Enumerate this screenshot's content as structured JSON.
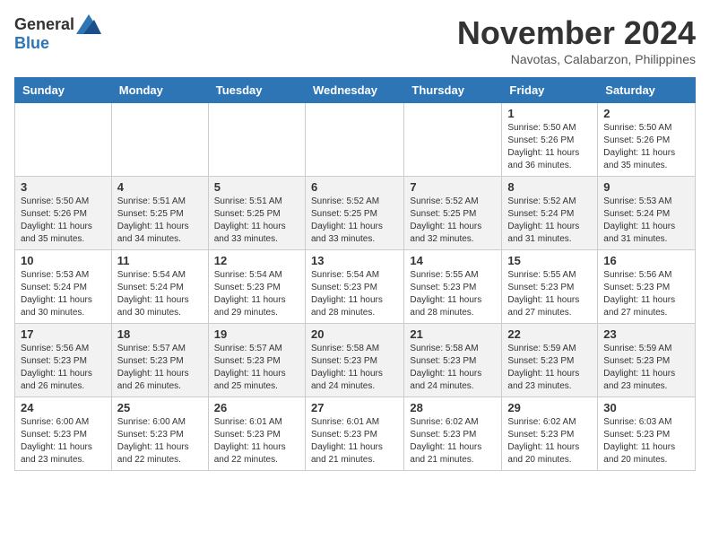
{
  "header": {
    "logo_general": "General",
    "logo_blue": "Blue",
    "month_title": "November 2024",
    "subtitle": "Navotas, Calabarzon, Philippines"
  },
  "weekdays": [
    "Sunday",
    "Monday",
    "Tuesday",
    "Wednesday",
    "Thursday",
    "Friday",
    "Saturday"
  ],
  "weeks": [
    [
      {
        "day": "",
        "info": ""
      },
      {
        "day": "",
        "info": ""
      },
      {
        "day": "",
        "info": ""
      },
      {
        "day": "",
        "info": ""
      },
      {
        "day": "",
        "info": ""
      },
      {
        "day": "1",
        "info": "Sunrise: 5:50 AM\nSunset: 5:26 PM\nDaylight: 11 hours and 36 minutes."
      },
      {
        "day": "2",
        "info": "Sunrise: 5:50 AM\nSunset: 5:26 PM\nDaylight: 11 hours and 35 minutes."
      }
    ],
    [
      {
        "day": "3",
        "info": "Sunrise: 5:50 AM\nSunset: 5:26 PM\nDaylight: 11 hours and 35 minutes."
      },
      {
        "day": "4",
        "info": "Sunrise: 5:51 AM\nSunset: 5:25 PM\nDaylight: 11 hours and 34 minutes."
      },
      {
        "day": "5",
        "info": "Sunrise: 5:51 AM\nSunset: 5:25 PM\nDaylight: 11 hours and 33 minutes."
      },
      {
        "day": "6",
        "info": "Sunrise: 5:52 AM\nSunset: 5:25 PM\nDaylight: 11 hours and 33 minutes."
      },
      {
        "day": "7",
        "info": "Sunrise: 5:52 AM\nSunset: 5:25 PM\nDaylight: 11 hours and 32 minutes."
      },
      {
        "day": "8",
        "info": "Sunrise: 5:52 AM\nSunset: 5:24 PM\nDaylight: 11 hours and 31 minutes."
      },
      {
        "day": "9",
        "info": "Sunrise: 5:53 AM\nSunset: 5:24 PM\nDaylight: 11 hours and 31 minutes."
      }
    ],
    [
      {
        "day": "10",
        "info": "Sunrise: 5:53 AM\nSunset: 5:24 PM\nDaylight: 11 hours and 30 minutes."
      },
      {
        "day": "11",
        "info": "Sunrise: 5:54 AM\nSunset: 5:24 PM\nDaylight: 11 hours and 30 minutes."
      },
      {
        "day": "12",
        "info": "Sunrise: 5:54 AM\nSunset: 5:23 PM\nDaylight: 11 hours and 29 minutes."
      },
      {
        "day": "13",
        "info": "Sunrise: 5:54 AM\nSunset: 5:23 PM\nDaylight: 11 hours and 28 minutes."
      },
      {
        "day": "14",
        "info": "Sunrise: 5:55 AM\nSunset: 5:23 PM\nDaylight: 11 hours and 28 minutes."
      },
      {
        "day": "15",
        "info": "Sunrise: 5:55 AM\nSunset: 5:23 PM\nDaylight: 11 hours and 27 minutes."
      },
      {
        "day": "16",
        "info": "Sunrise: 5:56 AM\nSunset: 5:23 PM\nDaylight: 11 hours and 27 minutes."
      }
    ],
    [
      {
        "day": "17",
        "info": "Sunrise: 5:56 AM\nSunset: 5:23 PM\nDaylight: 11 hours and 26 minutes."
      },
      {
        "day": "18",
        "info": "Sunrise: 5:57 AM\nSunset: 5:23 PM\nDaylight: 11 hours and 26 minutes."
      },
      {
        "day": "19",
        "info": "Sunrise: 5:57 AM\nSunset: 5:23 PM\nDaylight: 11 hours and 25 minutes."
      },
      {
        "day": "20",
        "info": "Sunrise: 5:58 AM\nSunset: 5:23 PM\nDaylight: 11 hours and 24 minutes."
      },
      {
        "day": "21",
        "info": "Sunrise: 5:58 AM\nSunset: 5:23 PM\nDaylight: 11 hours and 24 minutes."
      },
      {
        "day": "22",
        "info": "Sunrise: 5:59 AM\nSunset: 5:23 PM\nDaylight: 11 hours and 23 minutes."
      },
      {
        "day": "23",
        "info": "Sunrise: 5:59 AM\nSunset: 5:23 PM\nDaylight: 11 hours and 23 minutes."
      }
    ],
    [
      {
        "day": "24",
        "info": "Sunrise: 6:00 AM\nSunset: 5:23 PM\nDaylight: 11 hours and 23 minutes."
      },
      {
        "day": "25",
        "info": "Sunrise: 6:00 AM\nSunset: 5:23 PM\nDaylight: 11 hours and 22 minutes."
      },
      {
        "day": "26",
        "info": "Sunrise: 6:01 AM\nSunset: 5:23 PM\nDaylight: 11 hours and 22 minutes."
      },
      {
        "day": "27",
        "info": "Sunrise: 6:01 AM\nSunset: 5:23 PM\nDaylight: 11 hours and 21 minutes."
      },
      {
        "day": "28",
        "info": "Sunrise: 6:02 AM\nSunset: 5:23 PM\nDaylight: 11 hours and 21 minutes."
      },
      {
        "day": "29",
        "info": "Sunrise: 6:02 AM\nSunset: 5:23 PM\nDaylight: 11 hours and 20 minutes."
      },
      {
        "day": "30",
        "info": "Sunrise: 6:03 AM\nSunset: 5:23 PM\nDaylight: 11 hours and 20 minutes."
      }
    ]
  ]
}
